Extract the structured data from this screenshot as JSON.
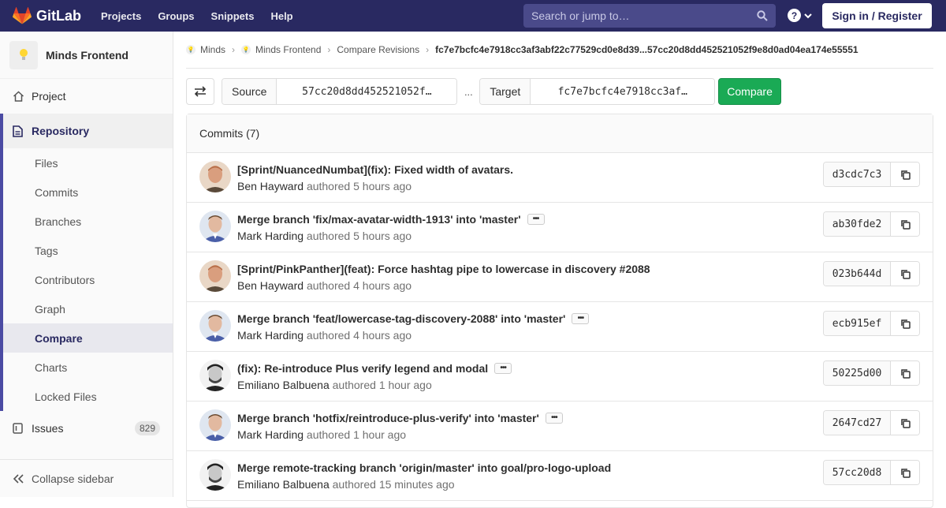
{
  "topbar": {
    "brand": "GitLab",
    "nav": [
      "Projects",
      "Groups",
      "Snippets",
      "Help"
    ],
    "search_placeholder": "Search or jump to…",
    "signin": "Sign in / Register"
  },
  "sidebar": {
    "project_name": "Minds Frontend",
    "project_link": "Project",
    "repository": "Repository",
    "repo_items": [
      "Files",
      "Commits",
      "Branches",
      "Tags",
      "Contributors",
      "Graph",
      "Compare",
      "Charts",
      "Locked Files"
    ],
    "active_item": "Compare",
    "issues": "Issues",
    "issues_count": "829",
    "collapse": "Collapse sidebar"
  },
  "breadcrumb": {
    "items": [
      "Minds",
      "Minds Frontend",
      "Compare Revisions"
    ],
    "current": "fc7e7bcfc4e7918cc3af3abf22c77529cd0e8d39...57cc20d8dd452521052f9e8d0ad04ea174e55551"
  },
  "compare_form": {
    "source_label": "Source",
    "source_value": "57cc20d8dd452521052f…",
    "separator": "...",
    "target_label": "Target",
    "target_value": "fc7e7bcfc4e7918cc3af…",
    "compare_button": "Compare"
  },
  "commits": {
    "header": "Commits (7)",
    "authored_word": "authored",
    "items": [
      {
        "title": "[Sprint/NuancedNumbat](fix): Fixed width of avatars.",
        "author": "Ben Hayward",
        "time": "5 hours ago",
        "sha": "d3cdc7c3",
        "more": false,
        "avatar": "ben"
      },
      {
        "title": "Merge branch 'fix/max-avatar-width-1913' into 'master'",
        "author": "Mark Harding",
        "time": "5 hours ago",
        "sha": "ab30fde2",
        "more": true,
        "avatar": "mark"
      },
      {
        "title": "[Sprint/PinkPanther](feat): Force hashtag pipe to lowercase in discovery #2088",
        "author": "Ben Hayward",
        "time": "4 hours ago",
        "sha": "023b644d",
        "more": false,
        "avatar": "ben"
      },
      {
        "title": "Merge branch 'feat/lowercase-tag-discovery-2088' into 'master'",
        "author": "Mark Harding",
        "time": "4 hours ago",
        "sha": "ecb915ef",
        "more": true,
        "avatar": "mark"
      },
      {
        "title": "(fix): Re-introduce Plus verify legend and modal",
        "author": "Emiliano Balbuena",
        "time": "1 hour ago",
        "sha": "50225d00",
        "more": true,
        "avatar": "emi"
      },
      {
        "title": "Merge branch 'hotfix/reintroduce-plus-verify' into 'master'",
        "author": "Mark Harding",
        "time": "1 hour ago",
        "sha": "2647cd27",
        "more": true,
        "avatar": "mark"
      },
      {
        "title": "Merge remote-tracking branch 'origin/master' into goal/pro-logo-upload",
        "author": "Emiliano Balbuena",
        "time": "15 minutes ago",
        "sha": "57cc20d8",
        "more": false,
        "avatar": "emi"
      }
    ]
  },
  "colors": {
    "topbar": "#292961",
    "accent": "#4b4ba3",
    "compare_button": "#1aaa55"
  }
}
